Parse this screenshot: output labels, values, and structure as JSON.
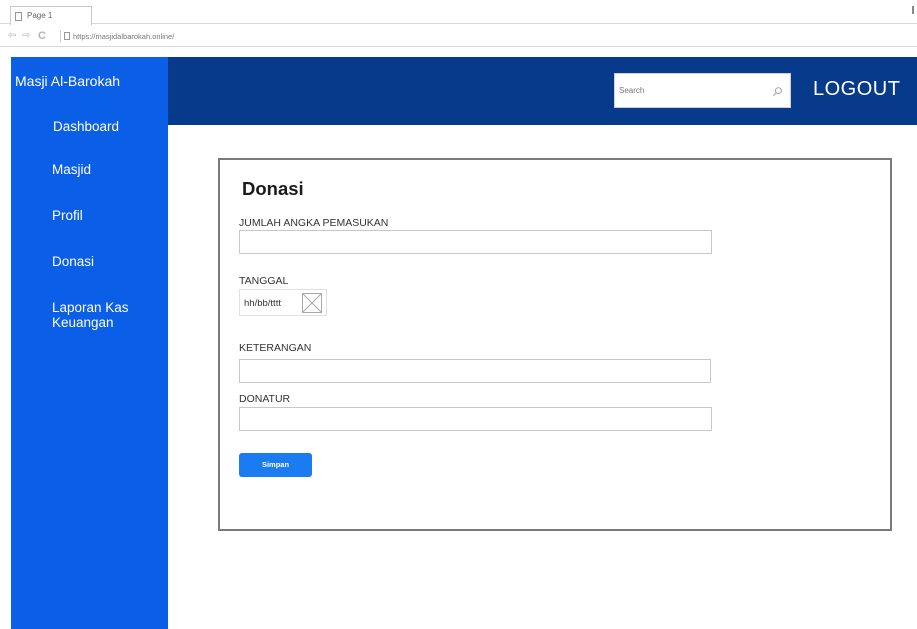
{
  "browser": {
    "tab_title": "Page 1",
    "url": "https://masjidalbarokah.online/"
  },
  "sidebar": {
    "brand": "Masji Al-Barokah",
    "items": [
      {
        "label": "Dashboard"
      },
      {
        "label": "Masjid"
      },
      {
        "label": "Profil"
      },
      {
        "label": "Donasi"
      },
      {
        "label": "Laporan Kas Keuangan"
      }
    ]
  },
  "header": {
    "search_placeholder": "Search",
    "logout_label": "LOGOUT"
  },
  "form": {
    "title": "Donasi",
    "amount_label": "JUMLAH ANGKA PEMASUKAN",
    "amount_value": "",
    "date_label": "TANGGAL",
    "date_value": "hh/bb/tttt",
    "description_label": "KETERANGAN",
    "description_value": "",
    "donor_label": "DONATUR",
    "donor_value": "",
    "save_label": "Simpan"
  },
  "colors": {
    "sidebar": "#0b5ee6",
    "header": "#083a8b",
    "button": "#1a7cf0"
  }
}
